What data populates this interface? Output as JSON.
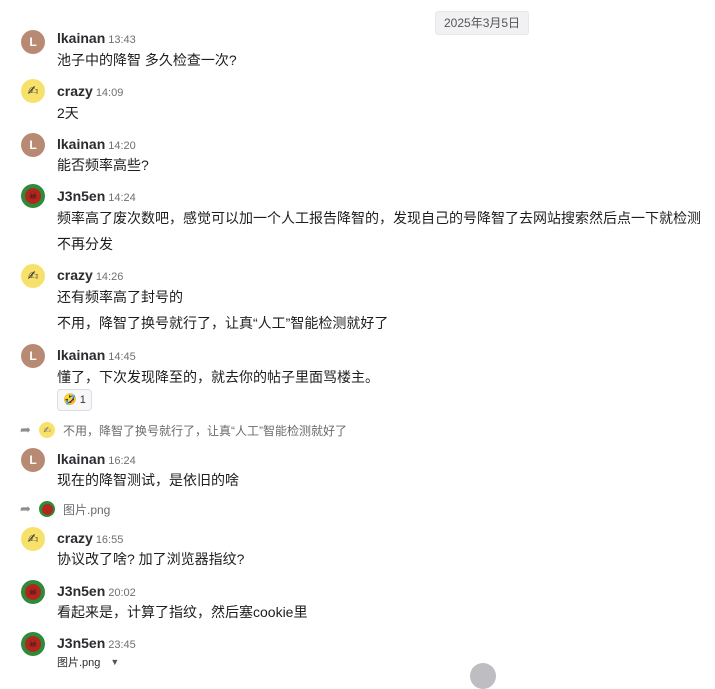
{
  "date_separator": "2025年3月5日",
  "messages": [
    {
      "avatar": "L",
      "name": "lkainan",
      "time": "13:43",
      "lines": [
        "池子中的降智 多久检查一次?"
      ]
    },
    {
      "avatar": "crazy",
      "name": "crazy",
      "time": "14:09",
      "lines": [
        "2天"
      ]
    },
    {
      "avatar": "L",
      "name": "lkainan",
      "time": "14:20",
      "lines": [
        "能否频率高些?"
      ]
    },
    {
      "avatar": "j",
      "name": "J3n5en",
      "time": "14:24",
      "lines": [
        "频率高了废次数吧，感觉可以加一个人工报告降智的，发现自己的号降智了去网站搜索然后点一下就检测",
        "不再分发"
      ]
    },
    {
      "avatar": "crazy",
      "name": "crazy",
      "time": "14:26",
      "lines": [
        "还有频率高了封号的",
        "不用，降智了换号就行了，让真“人工”智能检测就好了"
      ]
    },
    {
      "avatar": "L",
      "name": "lkainan",
      "time": "14:45",
      "lines": [
        "懂了，下次发现降至的，就去你的帖子里面骂楼主。"
      ],
      "reaction": {
        "emoji": "🤣",
        "count": "1"
      }
    },
    {
      "reply_preview": "不用，降智了换号就行了，让真“人工”智能检测就好了",
      "avatar": "L",
      "name": "lkainan",
      "time": "16:24",
      "lines": [
        "现在的降智测试，是依旧的啥"
      ]
    },
    {
      "reply_preview": "图片.png",
      "avatar": "crazy",
      "name": "crazy",
      "time": "16:55",
      "lines": [
        "协议改了啥?  加了浏览器指纹?"
      ]
    },
    {
      "avatar": "j",
      "name": "J3n5en",
      "time": "20:02",
      "lines": [
        "看起来是，计算了指纹，然后塞cookie里"
      ]
    },
    {
      "avatar": "j",
      "name": "J3n5en",
      "time": "23:45",
      "attachment": "图片.png"
    }
  ]
}
